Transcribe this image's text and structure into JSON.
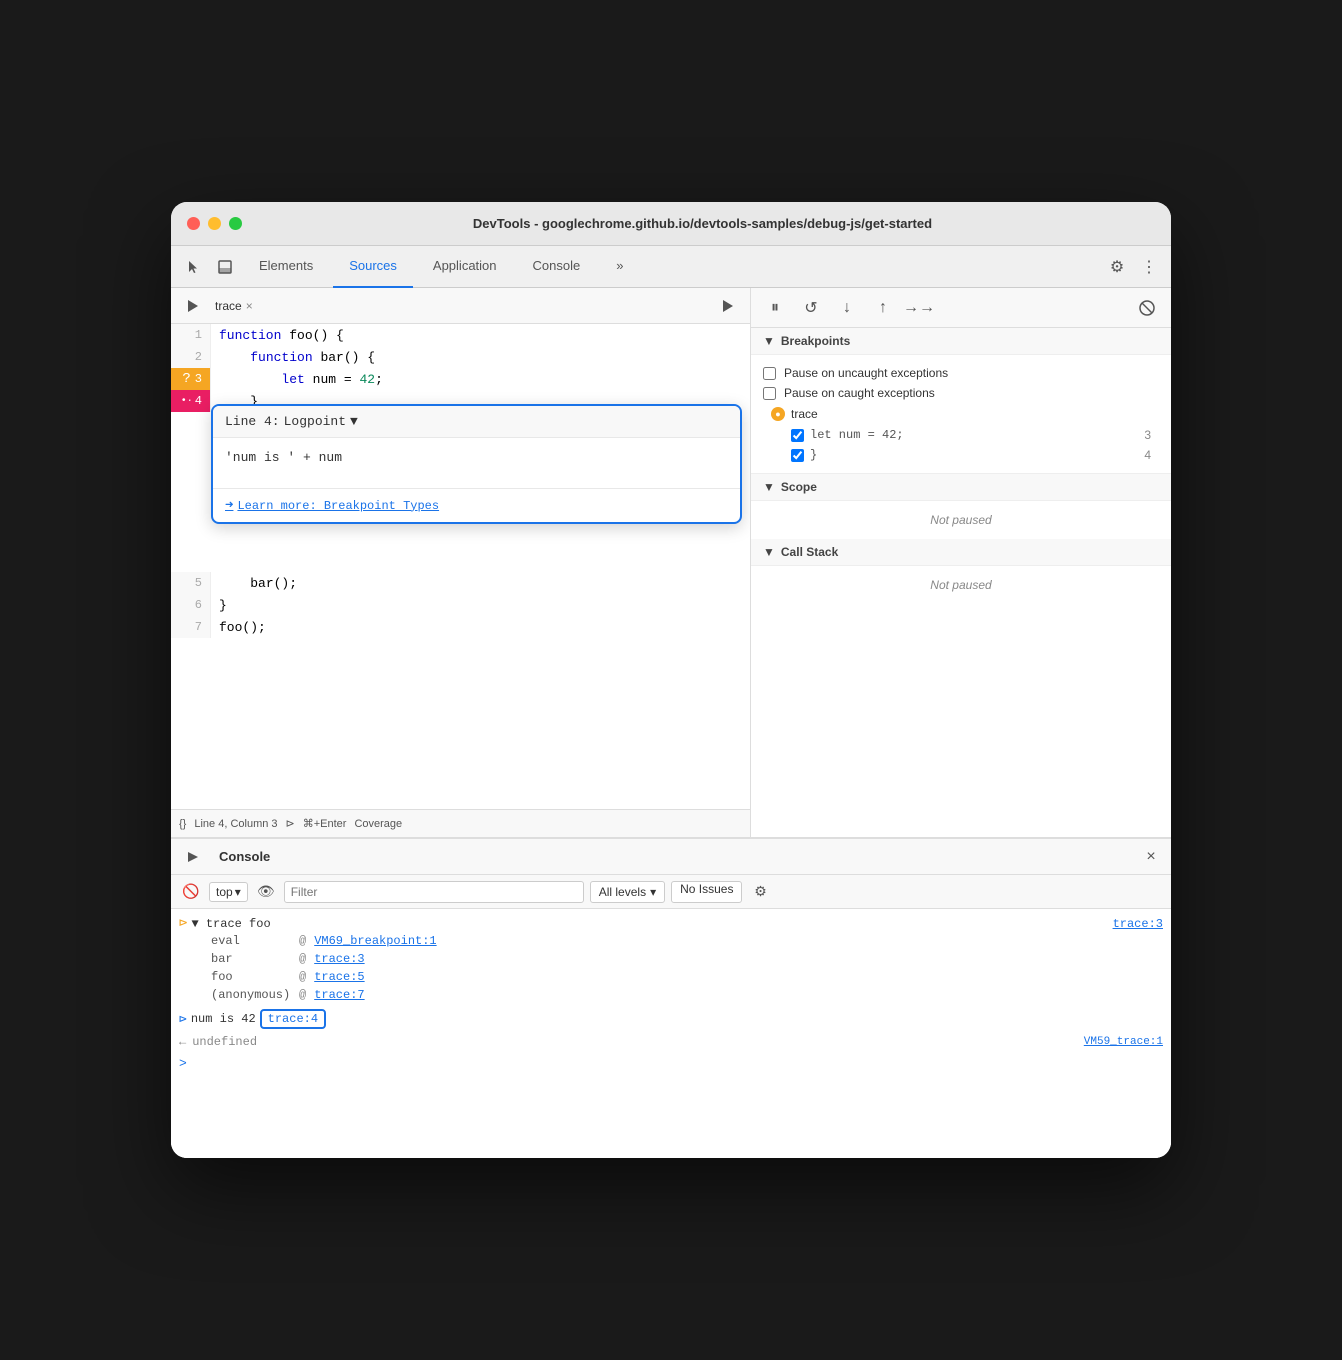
{
  "window": {
    "title": "DevTools - googlechrome.github.io/devtools-samples/debug-js/get-started"
  },
  "nav": {
    "tabs": [
      {
        "label": "Elements",
        "active": false
      },
      {
        "label": "Sources",
        "active": true
      },
      {
        "label": "Application",
        "active": false
      },
      {
        "label": "Console",
        "active": false
      }
    ],
    "more_label": "»"
  },
  "sources": {
    "file_tab": "trace",
    "file_tab_close": "×",
    "lines": [
      {
        "num": "1",
        "content": "function foo() {",
        "type": "code"
      },
      {
        "num": "2",
        "content": "    function bar() {",
        "type": "code"
      },
      {
        "num": "3",
        "content": "        let num = 42;",
        "type": "code",
        "bp": "yellow"
      },
      {
        "num": "4",
        "content": "    }",
        "type": "code",
        "bp": "pink"
      },
      {
        "num": "5",
        "content": "    bar();",
        "type": "code"
      },
      {
        "num": "6",
        "content": "}",
        "type": "code"
      },
      {
        "num": "7",
        "content": "foo();",
        "type": "code"
      }
    ],
    "status_bar": {
      "braces": "{}",
      "position": "Line 4, Column 3",
      "run_label": "⊳",
      "shortcut": "⌘+Enter",
      "coverage": "Coverage"
    }
  },
  "logpoint": {
    "line_label": "Line 4:",
    "type": "Logpoint",
    "dropdown_arrow": "▼",
    "input_value": "'num is ' + num",
    "learn_more_label": "Learn more: Breakpoint Types"
  },
  "debugger": {
    "breakpoints_section": "Breakpoints",
    "pause_uncaught": "Pause on uncaught exceptions",
    "pause_caught": "Pause on caught exceptions",
    "bp_file": "trace",
    "bp_items": [
      {
        "code": "let num = 42;",
        "line": "3",
        "checked": true
      },
      {
        "code": "}",
        "line": "4",
        "checked": true
      }
    ],
    "scope_section": "Scope",
    "scope_status": "Not paused",
    "callstack_section": "Call Stack",
    "callstack_status": "Not paused"
  },
  "console": {
    "title": "Console",
    "close_icon": "×",
    "filter_placeholder": "Filter",
    "levels_label": "All levels",
    "no_issues_label": "No Issues",
    "trace_entry": {
      "icon": "▶",
      "prefix": "▼ trace foo",
      "link": "trace:3",
      "items": [
        {
          "fn": "eval",
          "at": "@",
          "link": "VM69_breakpoint:1"
        },
        {
          "fn": "bar",
          "at": "@",
          "link": "trace:3"
        },
        {
          "fn": "foo",
          "at": "@",
          "link": "trace:5"
        },
        {
          "fn": "(anonymous)",
          "at": "@",
          "link": "trace:7"
        }
      ]
    },
    "result_entry": {
      "icon": "⊳",
      "text": "num is 42",
      "link": "trace:4",
      "link_outlined": true
    },
    "undefined_entry": {
      "prefix": "←",
      "text": "undefined",
      "link": "VM59_trace:1"
    },
    "prompt": ">"
  }
}
